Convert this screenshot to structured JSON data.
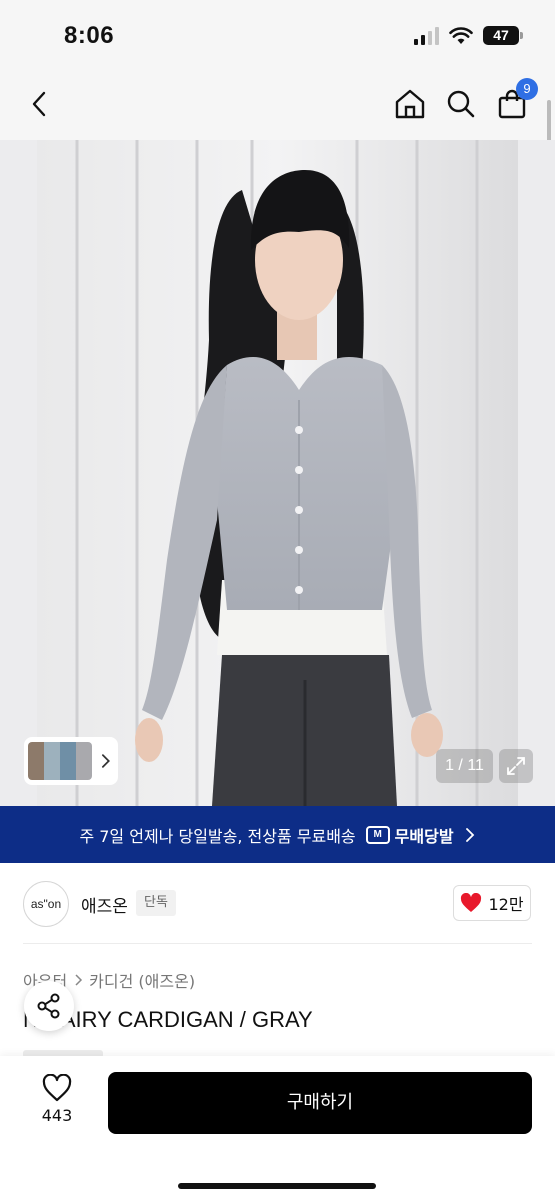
{
  "status_bar": {
    "time": "8:06",
    "battery": "47",
    "icons": [
      "signal-icon",
      "wifi-icon",
      "battery-icon"
    ]
  },
  "nav": {
    "icons": [
      "back-icon",
      "home-icon",
      "search-icon",
      "cart-icon"
    ],
    "cart_count": "9"
  },
  "gallery": {
    "counter": "1 / 11",
    "icons": [
      "chevron-right-icon",
      "expand-icon"
    ]
  },
  "banner": {
    "text": "주 7일 언제나 당일발송, 전상품 무료배송",
    "brand": "무배당발",
    "logo": "M"
  },
  "store": {
    "logo_text": "as\"on",
    "name": "애즈온",
    "tag": "단독",
    "likes": "12만"
  },
  "product": {
    "breadcrumb": [
      "아우터",
      "카디건 (애즈온)"
    ],
    "title": "N HAIRY CARDIGAN / GRAY"
  },
  "bottom_bar": {
    "wish_count": "443",
    "buy_label": "구매하기"
  },
  "colors": {
    "banner_bg": "#0d2d87",
    "badge": "#2f6fe4",
    "heart": "#e8192c",
    "buy_bg": "#000000"
  }
}
